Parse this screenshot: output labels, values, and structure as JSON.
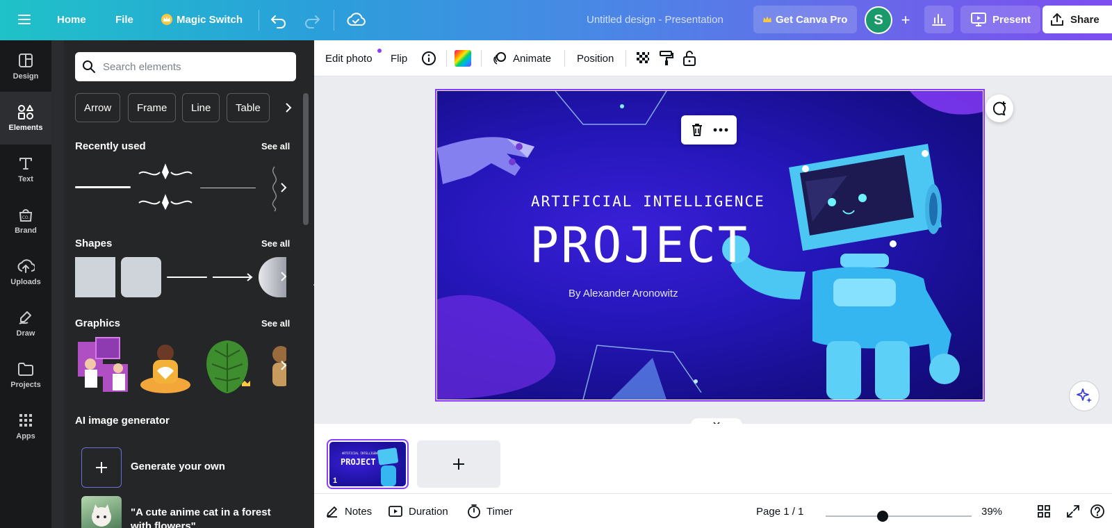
{
  "topbar": {
    "home": "Home",
    "file": "File",
    "magic_switch": "Magic Switch",
    "title": "Untitled design - Presentation",
    "get_pro": "Get Canva Pro",
    "avatar_initial": "S",
    "present": "Present",
    "share": "Share"
  },
  "rail": {
    "items": [
      {
        "label": "Design",
        "icon": "design-icon"
      },
      {
        "label": "Elements",
        "icon": "elements-icon",
        "active": true
      },
      {
        "label": "Text",
        "icon": "text-icon"
      },
      {
        "label": "Brand",
        "icon": "brand-icon"
      },
      {
        "label": "Uploads",
        "icon": "upload-icon"
      },
      {
        "label": "Draw",
        "icon": "draw-icon"
      },
      {
        "label": "Projects",
        "icon": "folder-icon"
      },
      {
        "label": "Apps",
        "icon": "apps-icon"
      }
    ]
  },
  "panel": {
    "search_placeholder": "Search elements",
    "chips": [
      "Arrow",
      "Frame",
      "Line",
      "Table"
    ],
    "recently_used": "Recently used",
    "shapes": "Shapes",
    "graphics": "Graphics",
    "see_all": "See all",
    "ai_generator": "AI image generator",
    "generate_own": "Generate your own",
    "ai_example": "\"A cute anime cat in a forest with flowers\""
  },
  "context_toolbar": {
    "edit_photo": "Edit photo",
    "flip": "Flip",
    "animate": "Animate",
    "position": "Position"
  },
  "slide": {
    "subtitle": "ARTIFICIAL INTELLIGENCE",
    "title": "PROJECT",
    "byline": "By Alexander Aronowitz"
  },
  "pages": {
    "thumb_number": "1"
  },
  "footer": {
    "notes": "Notes",
    "duration": "Duration",
    "timer": "Timer",
    "page_indicator": "Page 1 / 1",
    "zoom": "39%",
    "zoom_fraction": 0.39
  },
  "colors": {
    "accent": "#8b3dff",
    "topbar_start": "#1fc2c8",
    "topbar_end": "#7d4ef0",
    "panel_bg": "#252627",
    "rail_bg": "#18191b"
  }
}
